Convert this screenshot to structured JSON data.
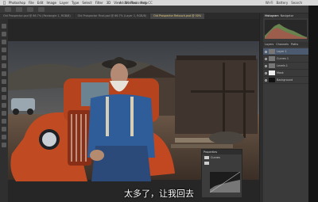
{
  "menubar": {
    "items": [
      "Photoshop",
      "File",
      "Edit",
      "Image",
      "Layer",
      "Type",
      "Select",
      "Filter",
      "3D",
      "View",
      "Window",
      "Help"
    ],
    "title": "Adobe Photoshop CC",
    "status": [
      "Wi-Fi",
      "Battery",
      "Search"
    ]
  },
  "tabs": [
    {
      "label": "Old Prospector.psd @ 66.7% (Rectangle 1, RGB/8)"
    },
    {
      "label": "Old Prospector Final.psd @ 66.7% (Layer 1, RGB/8)"
    },
    {
      "label": "Old Prospector Retouch.psd @ 50%"
    }
  ],
  "right_panel": {
    "top_tabs": [
      "Histogram",
      "Navigator"
    ],
    "props_tabs": [
      "Layers",
      "Channels",
      "Paths"
    ],
    "layers": [
      {
        "name": "Layer 1",
        "thumb": "grey"
      },
      {
        "name": "Curves 1",
        "thumb": "grey"
      },
      {
        "name": "Levels 1",
        "thumb": "grey"
      },
      {
        "name": "Mask",
        "thumb": "white"
      },
      {
        "name": "Background",
        "thumb": "dark"
      }
    ]
  },
  "float_panel": {
    "title": "Properties",
    "label": "Curves"
  },
  "subtitle": "太多了，让我回去",
  "colors": {
    "accent": "#e6c97a",
    "selection": "#4b5a6e"
  }
}
